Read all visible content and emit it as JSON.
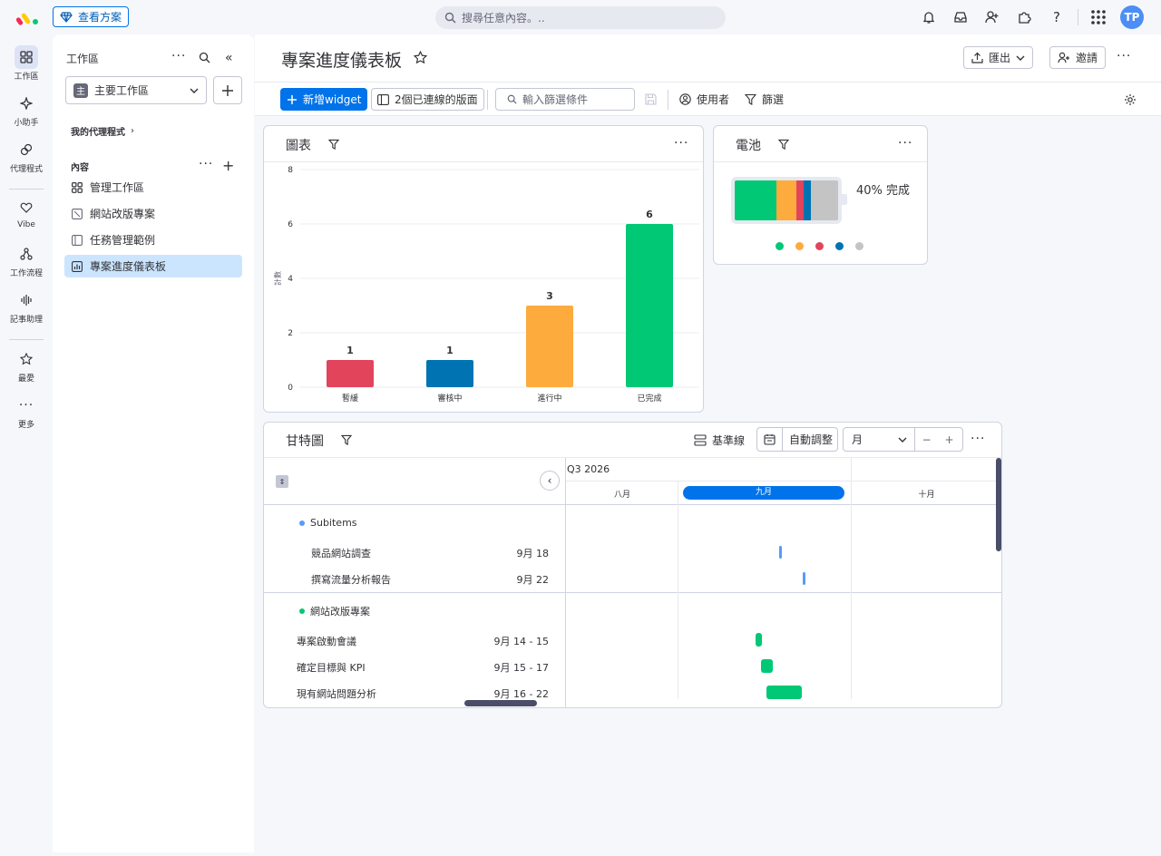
{
  "topbar": {
    "plans_label": "查看方案",
    "search_placeholder": "搜尋任意內容。.."
  },
  "user": {
    "initials": "TP"
  },
  "rail": [
    {
      "label": "工作區"
    },
    {
      "label": "小助手"
    },
    {
      "label": "代理程式"
    },
    {
      "label": "Vibe"
    },
    {
      "label": "工作流程"
    },
    {
      "label": "記事助理"
    },
    {
      "label": "最愛"
    },
    {
      "label": "更多"
    }
  ],
  "sidebar": {
    "title": "工作區",
    "workspace_badge": "主",
    "workspace_name": "主要工作區",
    "my_agents": "我的代理程式",
    "content_heading": "內容",
    "items": [
      {
        "label": "管理工作區"
      },
      {
        "label": "網站改版專案"
      },
      {
        "label": "任務管理範例"
      },
      {
        "label": "專案進度儀表板"
      }
    ]
  },
  "header": {
    "title": "專案進度儀表板",
    "export_label": "匯出",
    "invite_label": "邀請"
  },
  "toolbar": {
    "add_widget": "新增widget",
    "connected_boards": "2個已連線的版面",
    "filter_placeholder": "輸入篩選條件",
    "person_label": "使用者",
    "filter_label": "篩選"
  },
  "chart_widget": {
    "title": "圖表"
  },
  "chart_data": {
    "type": "bar",
    "categories": [
      "暫緩",
      "審核中",
      "進行中",
      "已完成"
    ],
    "values": [
      1,
      1,
      3,
      6
    ],
    "colors": [
      "#e2445c",
      "#0073b3",
      "#fdab3d",
      "#00c875"
    ],
    "ylabel": "計數",
    "ylim": [
      0,
      8
    ],
    "yticks": [
      0,
      2,
      4,
      6,
      8
    ],
    "grid": true,
    "data_labels": true
  },
  "battery_widget": {
    "title": "電池",
    "summary": "40% 完成",
    "segments": [
      {
        "color": "#00c875",
        "fraction": 0.4
      },
      {
        "color": "#fdab3d",
        "fraction": 0.2
      },
      {
        "color": "#e2445c",
        "fraction": 0.07
      },
      {
        "color": "#0073b3",
        "fraction": 0.07
      },
      {
        "color": "#c4c4c4",
        "fraction": 0.26
      }
    ],
    "legend_colors": [
      "#00c875",
      "#fdab3d",
      "#e2445c",
      "#0073b3",
      "#c4c4c4"
    ]
  },
  "gantt_widget": {
    "title": "甘特圖",
    "baseline_label": "基準線",
    "auto_fit_label": "自動調整",
    "scale_value": "月",
    "quarter_label": "Q3 2026",
    "months": [
      "八月",
      "九月",
      "十月"
    ],
    "groups": [
      {
        "name": "Subitems",
        "color": "#579bfc",
        "items": [
          {
            "name": "競品網站調查",
            "date": "9月 18"
          },
          {
            "name": "撰寫流量分析報告",
            "date": "9月 22"
          }
        ]
      },
      {
        "name": "網站改版專案",
        "color": "#00c875",
        "items": [
          {
            "name": "專案啟動會議",
            "date": "9月 14 - 15"
          },
          {
            "name": "確定目標與 KPI",
            "date": "9月 15 - 17"
          },
          {
            "name": "現有網站問題分析",
            "date": "9月 16 - 22"
          }
        ]
      }
    ]
  }
}
